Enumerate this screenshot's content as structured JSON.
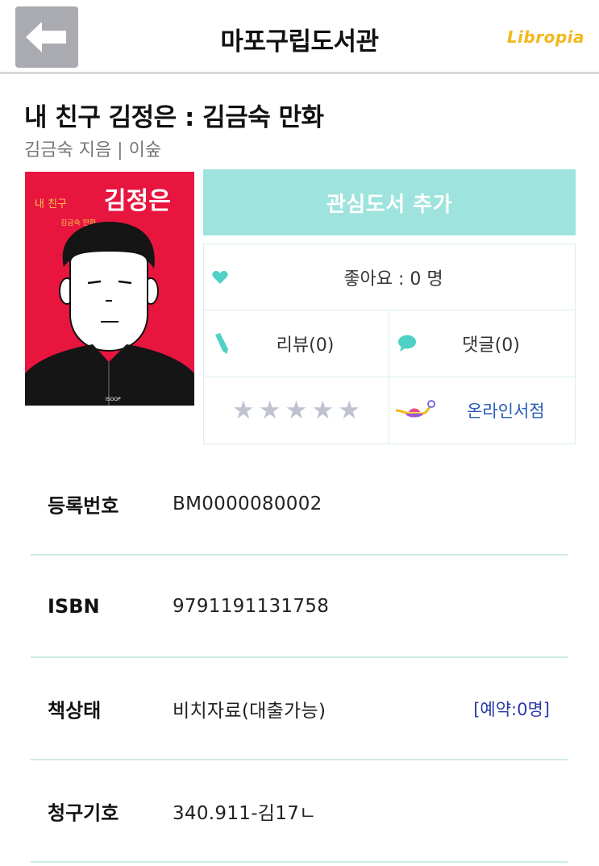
{
  "header": {
    "title": "마포구립도서관",
    "brand": "Libropia"
  },
  "book": {
    "title": "내 친구 김정은 : 김금숙 만화",
    "author_line": "김금숙 지음 | 이숲",
    "cover": {
      "small_title": "내 친구",
      "big_title": "김정은",
      "subtitle": "김금숙 만화"
    }
  },
  "actions": {
    "wishlist_label": "관심도서 추가",
    "like_label": "좋아요 : 0 명",
    "review_label": "리뷰(0)",
    "comment_label": "댓글(0)",
    "rating_stars": 5,
    "online_store_label": "온라인서점"
  },
  "info": [
    {
      "label": "등록번호",
      "value": "BM0000080002",
      "extra": ""
    },
    {
      "label": "ISBN",
      "value": "9791191131758",
      "extra": ""
    },
    {
      "label": "책상태",
      "value": "비치자료(대출가능)",
      "extra": "[예약:0명]"
    },
    {
      "label": "청구기호",
      "value": "340.911-김17ㄴ",
      "extra": ""
    }
  ],
  "colors": {
    "accent": "#9ee3dd",
    "brand": "#f2b81c",
    "link": "#2a5cb8",
    "cover_bg": "#e8153f"
  }
}
